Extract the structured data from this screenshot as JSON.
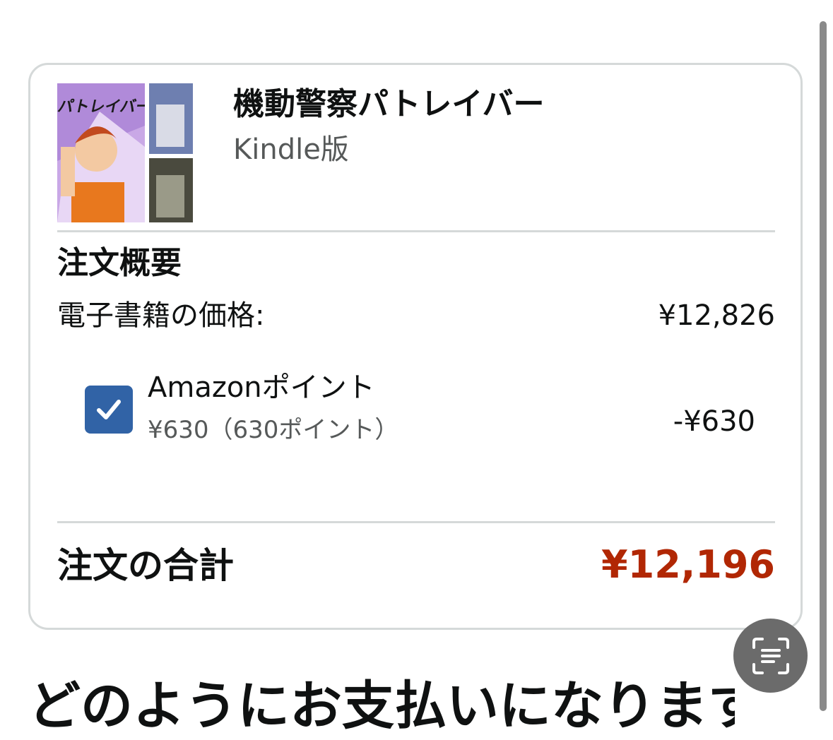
{
  "product": {
    "title": "機動警察パトレイバー",
    "format": "Kindle版",
    "cover_title_text": "パトレイバー"
  },
  "summary": {
    "heading": "注文概要",
    "ebook_price_label": "電子書籍の価格:",
    "ebook_price_value": "¥12,826",
    "points": {
      "checked": true,
      "label": "Amazonポイント",
      "detail": "¥630（630ポイント）",
      "value": "-¥630"
    },
    "total_label": "注文の合計",
    "total_value": "¥12,196"
  },
  "payment": {
    "heading": "どのようにお支払いになります"
  },
  "icons": {
    "checkbox": "checkmark-icon",
    "scan": "text-scan-icon"
  },
  "colors": {
    "total_price": "#b12704",
    "checkbox": "#3163a6",
    "border": "#d5d9d9",
    "secondary_text": "#565959"
  }
}
